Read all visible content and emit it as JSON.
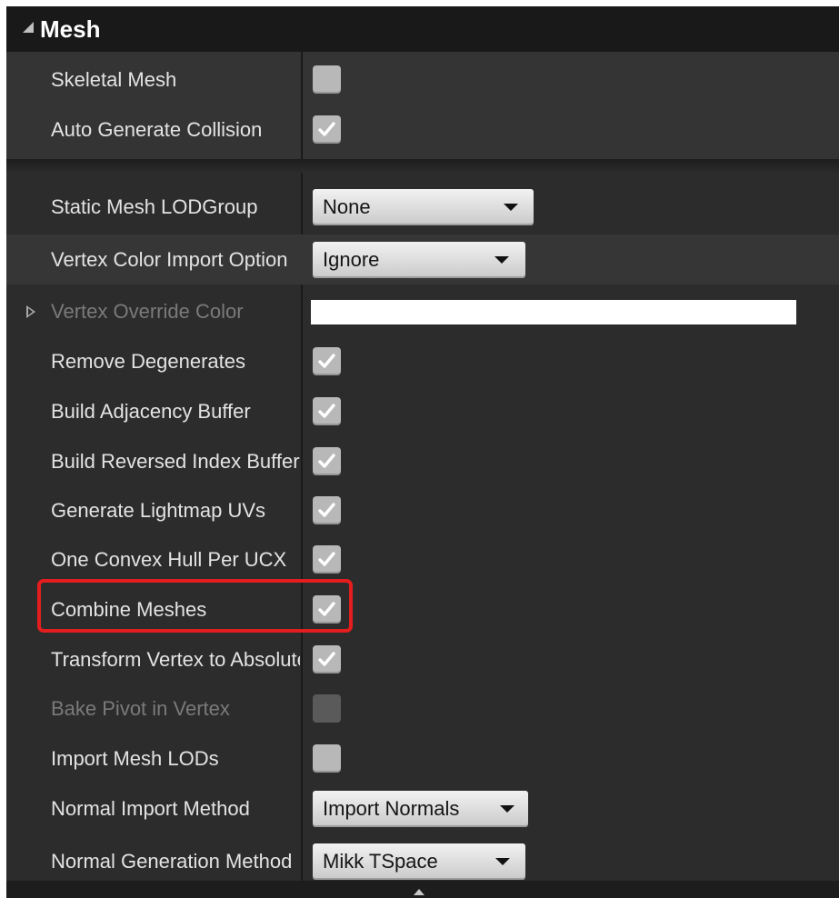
{
  "panel": {
    "title": "Mesh",
    "accent_color": "#e41e1e"
  },
  "section1": {
    "rows": [
      {
        "label": "Skeletal Mesh",
        "control": "checkbox",
        "checked": false
      },
      {
        "label": "Auto Generate Collision",
        "control": "checkbox",
        "checked": true
      }
    ]
  },
  "section2": {
    "static_mesh_lod_group": {
      "label": "Static Mesh LODGroup",
      "value": "None"
    },
    "vertex_color_import": {
      "label": "Vertex Color Import Option",
      "value": "Ignore"
    },
    "vertex_override_color": {
      "label": "Vertex Override Color",
      "color": "#ffffff"
    },
    "remove_degenerates": {
      "label": "Remove Degenerates",
      "checked": true
    },
    "build_adjacency_buffer": {
      "label": "Build Adjacency Buffer",
      "checked": true
    },
    "build_reversed_index_buffer": {
      "label": "Build Reversed Index Buffer",
      "checked": true
    },
    "generate_lightmap_uvs": {
      "label": "Generate Lightmap UVs",
      "checked": true
    },
    "one_convex_hull_per_ucx": {
      "label": "One Convex Hull Per UCX",
      "checked": true
    },
    "combine_meshes": {
      "label": "Combine Meshes",
      "checked": true
    },
    "transform_vertex_to_absolute": {
      "label": "Transform Vertex to Absolute",
      "checked": true
    },
    "bake_pivot_in_vertex": {
      "label": "Bake Pivot in Vertex",
      "checked": false
    },
    "import_mesh_lods": {
      "label": "Import Mesh LODs",
      "checked": false
    },
    "normal_import_method": {
      "label": "Normal Import Method",
      "value": "Import Normals"
    },
    "normal_generation_method": {
      "label": "Normal Generation Method",
      "value": "Mikk TSpace"
    }
  }
}
